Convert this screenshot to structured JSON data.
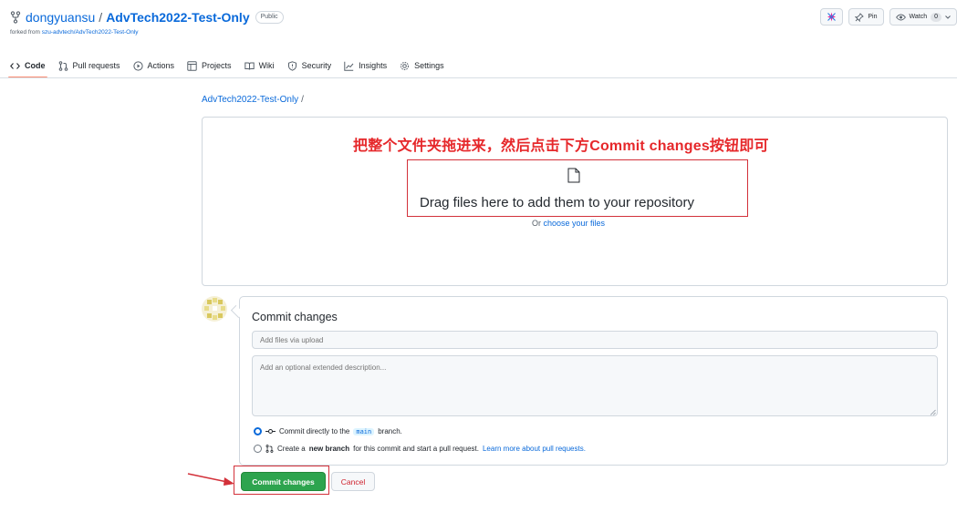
{
  "repo": {
    "owner": "dongyuansu",
    "separator": "/",
    "name": "AdvTech2022-Test-Only",
    "visibility": "Public",
    "forked_prefix": "forked from ",
    "forked_source": "szu-advtech/AdvTech2022-Test-Only"
  },
  "header_actions": {
    "pin_label": "Pin",
    "watch_label": "Watch",
    "watch_count": "0"
  },
  "tabs": [
    {
      "label": "Code",
      "icon": "code-icon",
      "active": true
    },
    {
      "label": "Pull requests",
      "icon": "pull-request-icon"
    },
    {
      "label": "Actions",
      "icon": "play-icon"
    },
    {
      "label": "Projects",
      "icon": "table-icon"
    },
    {
      "label": "Wiki",
      "icon": "book-icon"
    },
    {
      "label": "Security",
      "icon": "shield-icon"
    },
    {
      "label": "Insights",
      "icon": "graph-icon"
    },
    {
      "label": "Settings",
      "icon": "gear-icon"
    }
  ],
  "breadcrumb": {
    "repo_link": "AdvTech2022-Test-Only",
    "separator": "/"
  },
  "upload": {
    "annotation": "把整个文件夹拖进来，然后点击下方Commit changes按钮即可",
    "drag_text": "Drag files here to add them to your repository",
    "or_text": "Or ",
    "choose_link": "choose your files"
  },
  "commit": {
    "title": "Commit changes",
    "summary_placeholder": "Add files via upload",
    "description_placeholder": "Add an optional extended description...",
    "option_direct_prefix": "Commit directly to the",
    "option_direct_branch": "main",
    "option_direct_suffix": "branch.",
    "option_new_prefix": "Create a",
    "option_new_bold": "new branch",
    "option_new_suffix": "for this commit and start a pull request.",
    "option_new_link": "Learn more about pull requests."
  },
  "buttons": {
    "commit_label": "Commit changes",
    "cancel_label": "Cancel"
  },
  "colors": {
    "link": "#0969da",
    "primary": "#2da44e",
    "danger": "#cf222e",
    "annotation": "#e6282b",
    "active_tab_underline": "#fd8c73"
  }
}
